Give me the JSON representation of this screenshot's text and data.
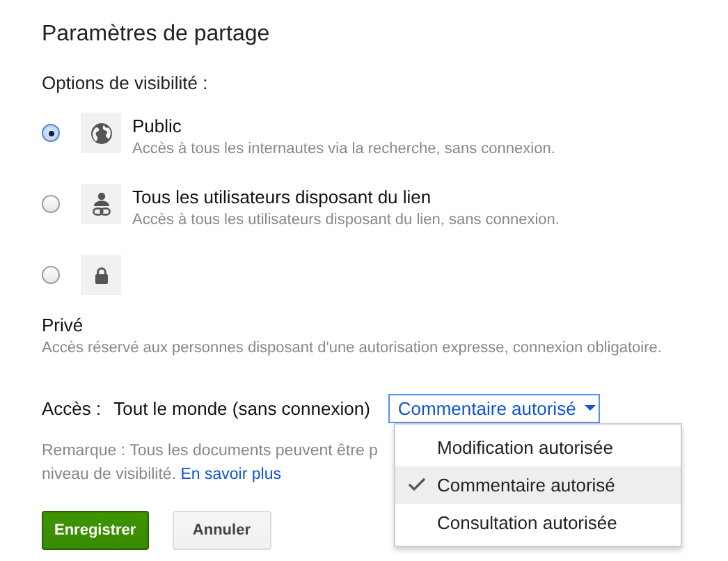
{
  "title": "Paramètres de partage",
  "visibility": {
    "heading": "Options de visibilité :",
    "options": [
      {
        "kind": "public",
        "title": "Public",
        "description": "Accès à tous les internautes via la recherche, sans connexion.",
        "selected": true
      },
      {
        "kind": "link",
        "title": "Tous les utilisateurs disposant du lien",
        "description": "Accès à tous les utilisateurs disposant du lien, sans connexion.",
        "selected": false
      },
      {
        "kind": "private",
        "title": "Privé",
        "description": "Accès réservé aux personnes disposant d'une autorisation expresse, connexion obligatoire.",
        "selected": false
      }
    ]
  },
  "access": {
    "label": "Accès :",
    "value": "Tout le monde (sans connexion)",
    "dropdown": "Commentaire autorisé",
    "menu": [
      {
        "label": "Modification autorisée",
        "selected": false
      },
      {
        "label": "Commentaire autorisé",
        "selected": true
      },
      {
        "label": "Consultation autorisée",
        "selected": false
      }
    ]
  },
  "note": {
    "lines": [
      "Remarque : Tous les documents peuvent être p",
      "niveau de visibilité."
    ],
    "link": "En savoir plus"
  },
  "buttons": [
    {
      "kind": "primary",
      "label": "Enregistrer"
    },
    {
      "kind": "secondary",
      "label": "Annuler"
    }
  ]
}
